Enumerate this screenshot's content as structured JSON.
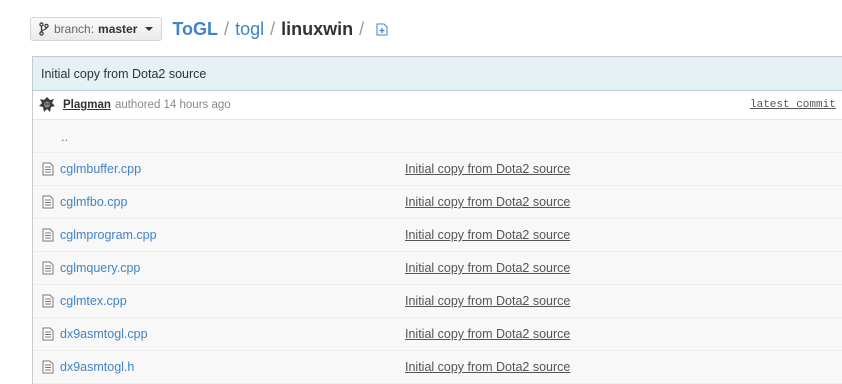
{
  "branch": {
    "prefix": "branch:",
    "name": "master"
  },
  "breadcrumb": {
    "root": "ToGL",
    "parts": [
      "togl"
    ],
    "current": "linuxwin",
    "separator": "/"
  },
  "latest_commit": {
    "message": "Initial copy from Dota2 source",
    "author": "Plagman",
    "authored_text": "authored 14 hours ago",
    "label": "latest commit"
  },
  "up_dir": "..",
  "files": [
    {
      "name": "cglmbuffer.cpp",
      "message": "Initial copy from Dota2 source"
    },
    {
      "name": "cglmfbo.cpp",
      "message": "Initial copy from Dota2 source"
    },
    {
      "name": "cglmprogram.cpp",
      "message": "Initial copy from Dota2 source"
    },
    {
      "name": "cglmquery.cpp",
      "message": "Initial copy from Dota2 source"
    },
    {
      "name": "cglmtex.cpp",
      "message": "Initial copy from Dota2 source"
    },
    {
      "name": "dx9asmtogl.cpp",
      "message": "Initial copy from Dota2 source"
    },
    {
      "name": "dx9asmtogl.h",
      "message": "Initial copy from Dota2 source"
    }
  ],
  "colors": {
    "link": "#4183c4",
    "commit_bar": "#e6f1f6"
  },
  "icons": {
    "branch": "git-branch-icon",
    "add_file": "file-add-icon",
    "file": "file-text-icon",
    "avatar": "user-avatar"
  }
}
